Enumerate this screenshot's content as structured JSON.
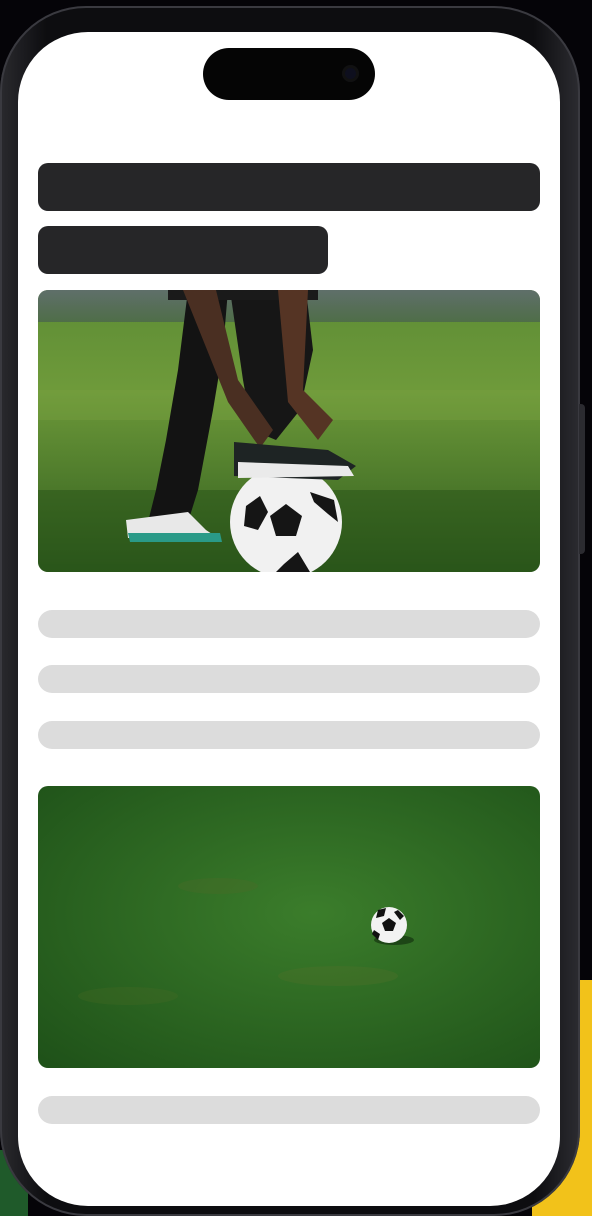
{
  "screen": {
    "colors": {
      "frame": "#0d0d10",
      "screen_background": "#ffffff",
      "title_skeleton": "#262628",
      "text_skeleton": "#dcdcdc",
      "grass": "#2f6b22"
    },
    "feed": {
      "title_lines": 2,
      "text_lines_after_first_photo": 3,
      "text_lines_after_second_photo": 1
    },
    "images": [
      {
        "subject": "player-tying-cleats-on-soccer-ball"
      },
      {
        "subject": "soccer-ball-on-grass-field"
      }
    ]
  }
}
